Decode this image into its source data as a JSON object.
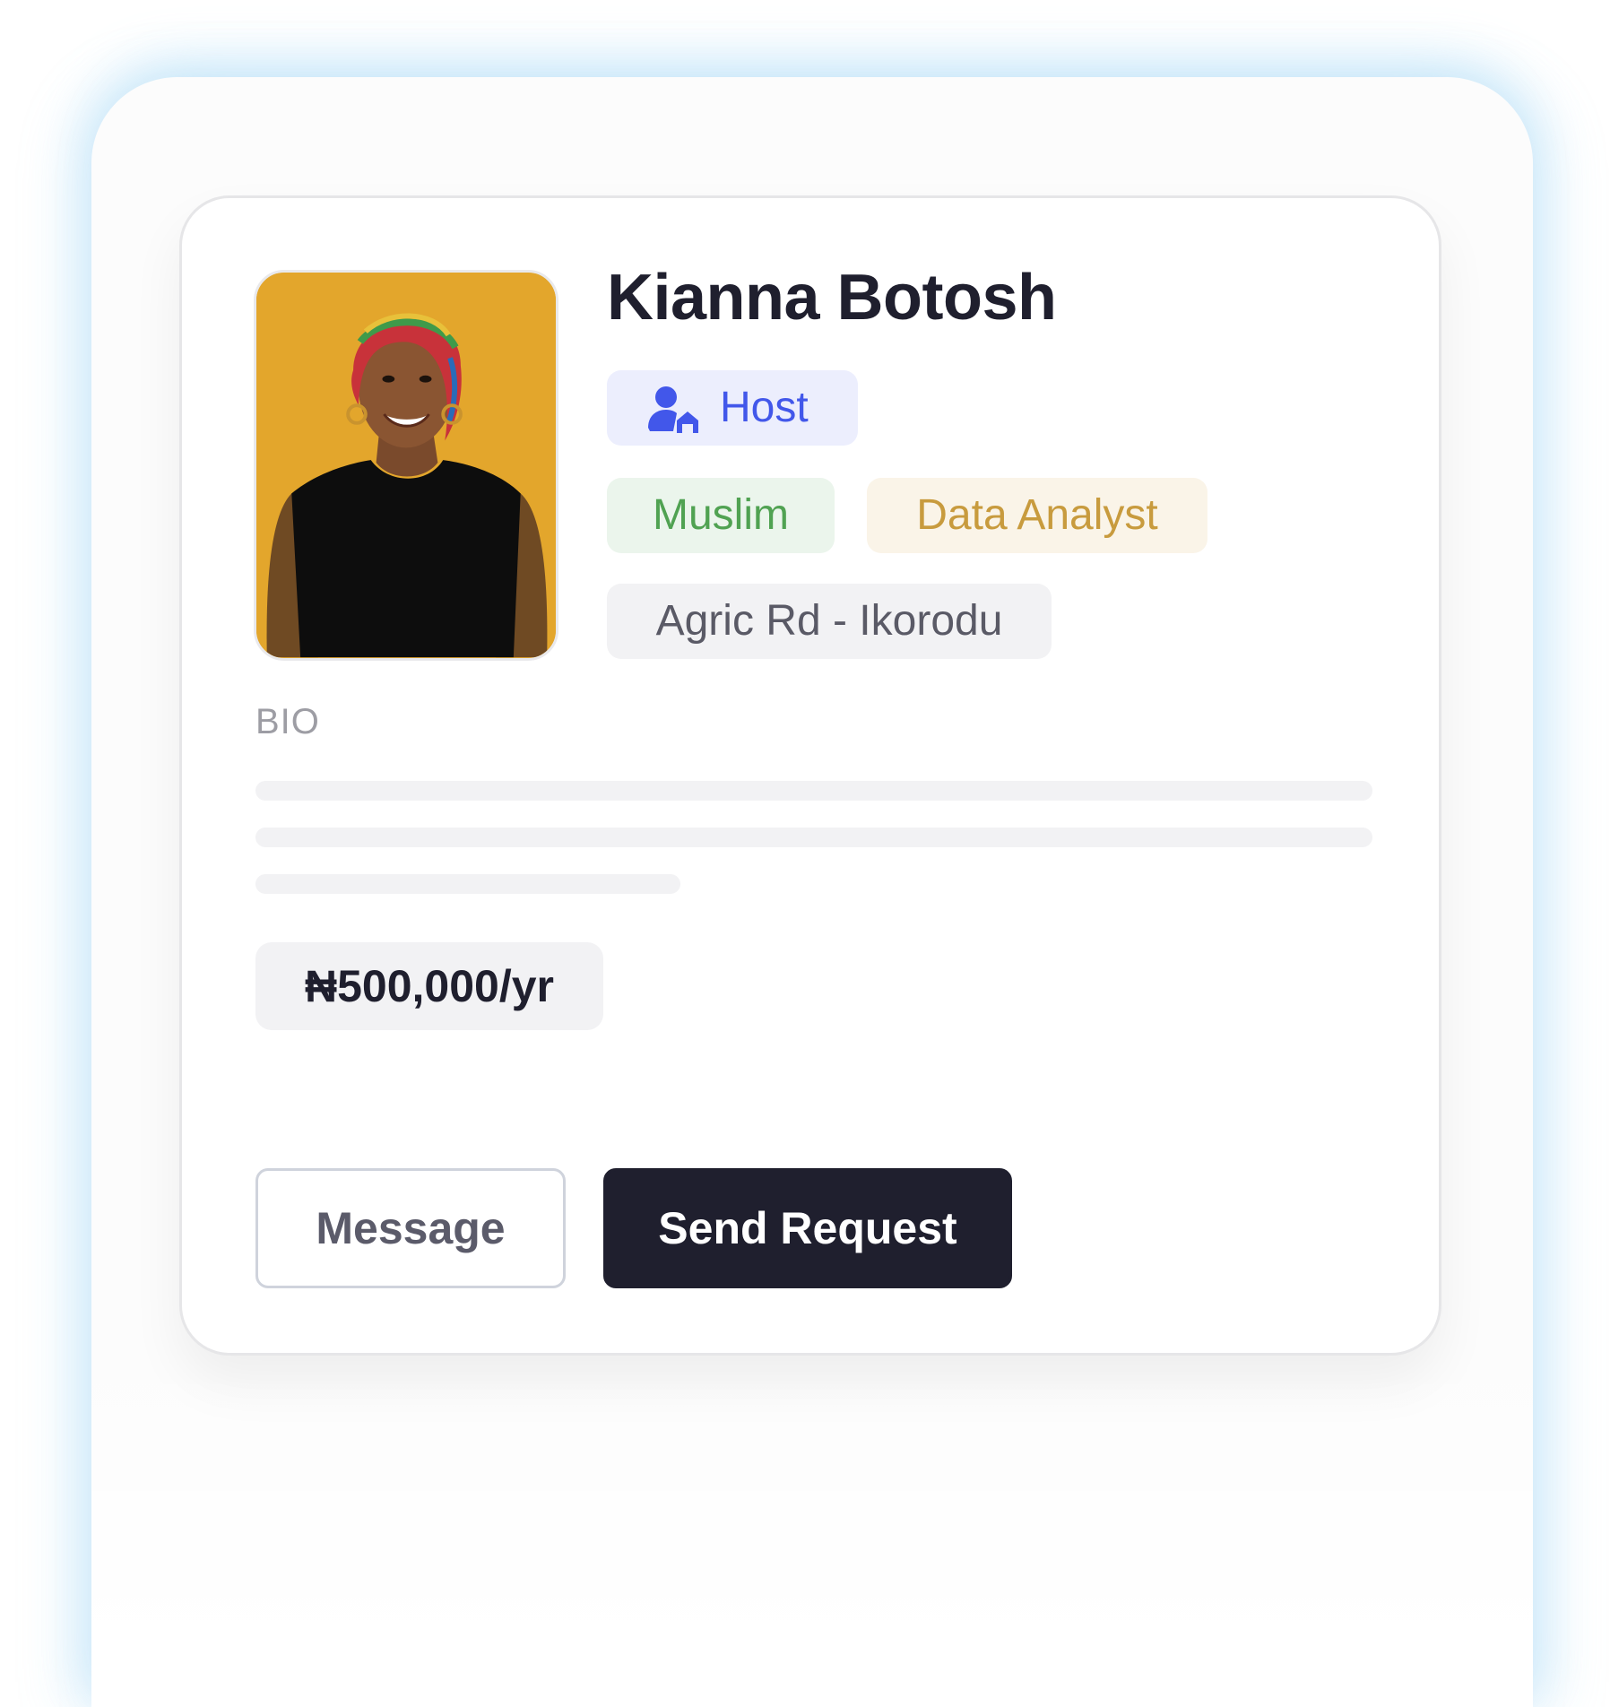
{
  "profile": {
    "name": "Kianna Botosh",
    "photo_alt": "profile-photo",
    "role": {
      "label": "Host",
      "icon": "host-user-icon",
      "color": "#4257ea"
    },
    "tags": {
      "religion": "Muslim",
      "occupation": "Data Analyst",
      "location": "Agric Rd - Ikorodu"
    },
    "bio_label": "BIO",
    "price": "₦500,000/yr"
  },
  "actions": {
    "message_label": "Message",
    "request_label": "Send Request"
  },
  "colors": {
    "primary_dark": "#1f1f2e",
    "host_bg": "#eceefd",
    "religion_text": "#50a252",
    "occupation_text": "#c89b3e",
    "photo_bg": "#e3a62c"
  }
}
